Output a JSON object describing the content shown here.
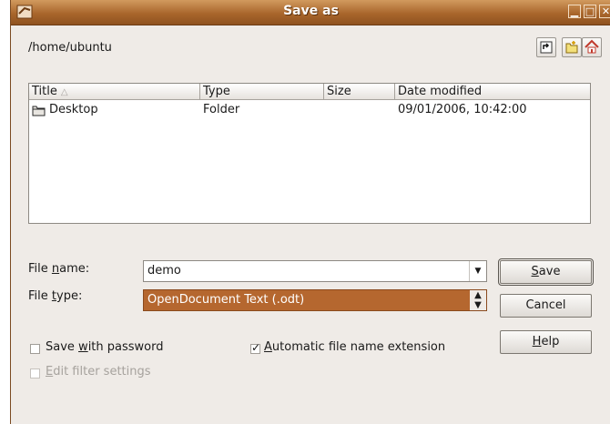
{
  "window": {
    "title": "Save as",
    "controls": [
      "minimize",
      "maximize",
      "close"
    ]
  },
  "path": "/home/ubuntu",
  "toolbar": [
    "up-one-level",
    "create-new-folder",
    "home"
  ],
  "file_list": {
    "columns": [
      "Title",
      "Type",
      "Size",
      "Date modified"
    ],
    "rows": [
      {
        "title": "Desktop",
        "type": "Folder",
        "size": "",
        "date": "09/01/2006, 10:42:00"
      }
    ]
  },
  "form": {
    "file_name": {
      "label_pre": "File ",
      "label_key": "n",
      "label_post": "ame:",
      "value": "demo"
    },
    "file_type": {
      "label_pre": "File ",
      "label_key": "t",
      "label_post": "ype:",
      "value": "OpenDocument Text (.odt)"
    }
  },
  "buttons": {
    "save": {
      "key": "S",
      "rest": "ave"
    },
    "cancel": "Cancel",
    "help": {
      "key": "H",
      "rest": "elp"
    }
  },
  "options": {
    "save_with_password": {
      "pre": "Save ",
      "key": "w",
      "post": "ith password",
      "checked": false
    },
    "automatic_extension": {
      "pre": "",
      "key": "A",
      "post": "utomatic file name extension",
      "checked": true
    },
    "edit_filter_settings": {
      "pre": "",
      "key": "E",
      "post": "dit filter settings",
      "checked": false,
      "enabled": false
    }
  },
  "colors": {
    "titlebar": "#a9662c",
    "selection": "#b5672f",
    "dialog_bg": "#efebe7"
  }
}
